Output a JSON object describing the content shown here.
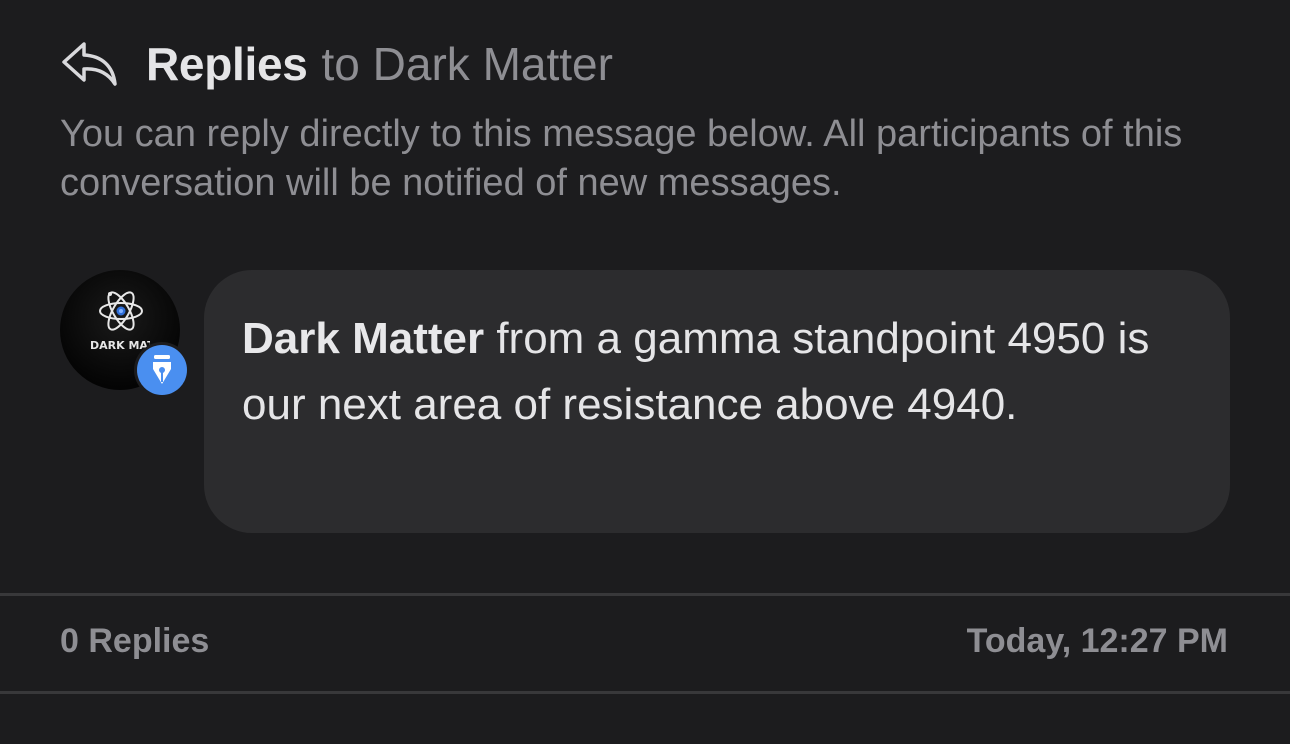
{
  "header": {
    "title_strong": "Replies",
    "title_rest": "to Dark Matter",
    "icon": "reply-arrow-icon"
  },
  "description": "You can reply directly to this message below. All participants of this conversation will be notified of new messages.",
  "message": {
    "author": "Dark Matter",
    "text": "from a gamma standpoint 4950 is our next area of resistance above 4940.",
    "avatar_label": "DARK MATTER",
    "badge_icon": "fountain-pen-icon"
  },
  "footer": {
    "replies_count": "0 Replies",
    "timestamp": "Today, 12:27 PM"
  },
  "colors": {
    "background": "#1c1c1e",
    "bubble": "#2c2c2e",
    "badge": "#4a8ff0",
    "muted_text": "#8e8e93"
  }
}
